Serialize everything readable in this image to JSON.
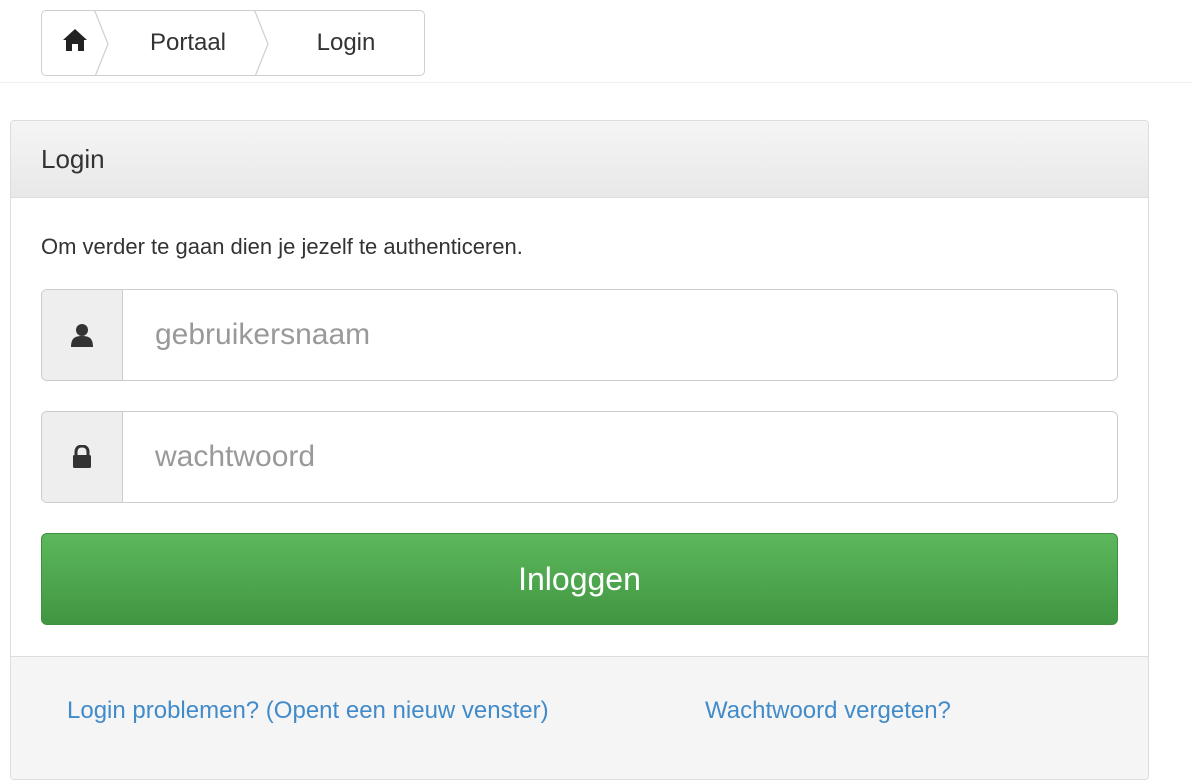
{
  "breadcrumb": {
    "home_icon": "home-icon",
    "items": [
      {
        "label": "Portaal"
      },
      {
        "label": "Login"
      }
    ]
  },
  "panel": {
    "title": "Login",
    "intro": "Om verder te gaan dien je jezelf te authenticeren.",
    "username": {
      "icon": "user-icon",
      "placeholder": "gebruikersnaam",
      "value": ""
    },
    "password": {
      "icon": "lock-icon",
      "placeholder": "wachtwoord",
      "value": ""
    },
    "submit_label": "Inloggen",
    "submit_color": "#5cb85c",
    "footer": {
      "problems_link": "Login problemen? (Opent een nieuw venster)",
      "forgot_link": "Wachtwoord vergeten?"
    },
    "link_color": "#428bca"
  }
}
